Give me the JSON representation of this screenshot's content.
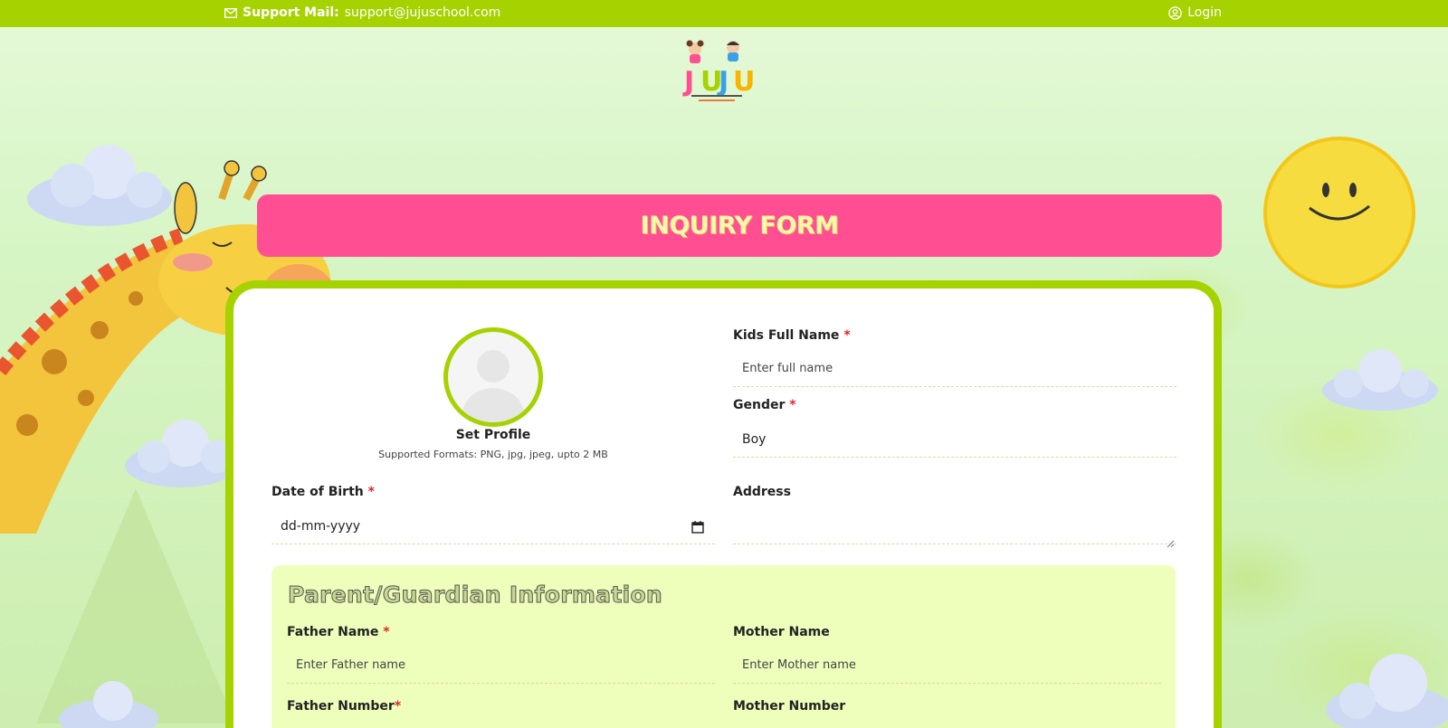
{
  "topbar": {
    "mail_label": "Support Mail:",
    "mail_value": "support@jujuschool.com",
    "login_label": "Login"
  },
  "colors": {
    "accent": "#a6d200",
    "banner": "#ff4f92",
    "banner_text": "#fff7a8",
    "required": "#e0262b",
    "parent_panel": "#edffbb"
  },
  "form": {
    "title": "INQUIRY FORM",
    "profile": {
      "set_label": "Set Profile",
      "formats": "Supported Formats: PNG, jpg, jpeg, upto 2 MB"
    },
    "kids_name": {
      "label": "Kids Full Name",
      "required": "*",
      "placeholder": "Enter full name"
    },
    "gender": {
      "label": "Gender",
      "required": "*",
      "value": "Boy"
    },
    "dob": {
      "label": "Date of Birth",
      "required": "*",
      "value": "dd-mm-yyyy"
    },
    "address": {
      "label": "Address"
    },
    "parent_section": {
      "heading": "Parent/Guardian Information",
      "father_name": {
        "label": "Father Name",
        "required": "*",
        "placeholder": "Enter Father name"
      },
      "mother_name": {
        "label": "Mother Name",
        "placeholder": "Enter Mother name"
      },
      "father_number": {
        "label": "Father Number",
        "required": "*"
      },
      "mother_number": {
        "label": "Mother Number"
      }
    }
  },
  "icons": {
    "mail": "envelope-icon",
    "login": "user-circle-icon",
    "calendar": "calendar-icon"
  }
}
